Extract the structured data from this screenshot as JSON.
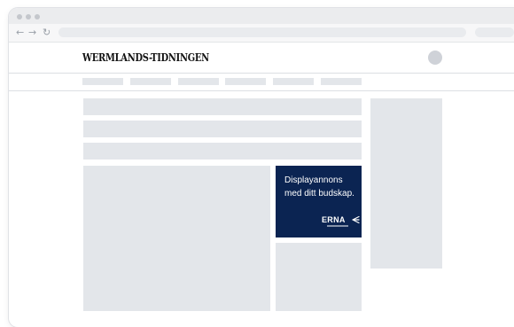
{
  "browser": {
    "back_icon": "back-arrow-icon",
    "forward_icon": "forward-arrow-icon",
    "reload_icon": "reload-icon",
    "back_glyph": "←",
    "forward_glyph": "→",
    "reload_glyph": "↻"
  },
  "header": {
    "logo": "WERMLANDS-TIDNINGEN",
    "avatar_icon": "user-avatar-icon"
  },
  "ad": {
    "text": "Displayannons med ditt budskap.",
    "brand": "ERNA",
    "background": "#0b2452",
    "text_color": "#ffffff"
  },
  "colors": {
    "placeholder": "#e3e6ea",
    "chrome": "#ebecee",
    "divider": "#dcdfe3"
  }
}
